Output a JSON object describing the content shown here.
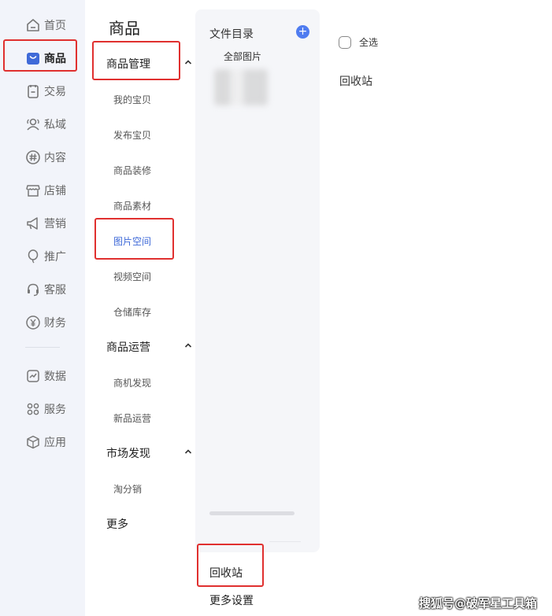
{
  "rail": {
    "items": [
      {
        "label": "首页",
        "icon": "home-icon"
      },
      {
        "label": "商品",
        "icon": "shopping-bag-icon",
        "active": true
      },
      {
        "label": "交易",
        "icon": "clipboard-icon"
      },
      {
        "label": "私域",
        "icon": "users-icon"
      },
      {
        "label": "内容",
        "icon": "hashtag-icon"
      },
      {
        "label": "店铺",
        "icon": "store-icon"
      },
      {
        "label": "营销",
        "icon": "megaphone-icon"
      },
      {
        "label": "推广",
        "icon": "balloon-icon"
      },
      {
        "label": "客服",
        "icon": "headset-icon"
      },
      {
        "label": "财务",
        "icon": "yuan-icon"
      },
      {
        "label": "数据",
        "icon": "chart-icon"
      },
      {
        "label": "服务",
        "icon": "grid-icon"
      },
      {
        "label": "应用",
        "icon": "cube-icon"
      }
    ]
  },
  "subnav": {
    "title": "商品",
    "groups": [
      {
        "label": "商品管理",
        "items": [
          "我的宝贝",
          "发布宝贝",
          "商品装修",
          "商品素材",
          "图片空间",
          "视频空间",
          "仓储库存"
        ]
      },
      {
        "label": "商品运营",
        "items": [
          "商机发现",
          "新品运营"
        ]
      },
      {
        "label": "市场发现",
        "items": [
          "淘分销"
        ]
      }
    ],
    "more": "更多"
  },
  "folders": {
    "title": "文件目录",
    "add_symbol": "+",
    "all_images": "全部图片",
    "recycle_bin": "回收站",
    "more_settings": "更多设置"
  },
  "content": {
    "select_all": "全选",
    "recycle_bin": "回收站"
  },
  "watermark": "搜狐号@破军星工具箱",
  "colors": {
    "accent": "#3f6ad8",
    "annotation_red": "#e0302f",
    "rail_bg": "#f2f4fa",
    "panel_bg": "#f5f6f9"
  }
}
